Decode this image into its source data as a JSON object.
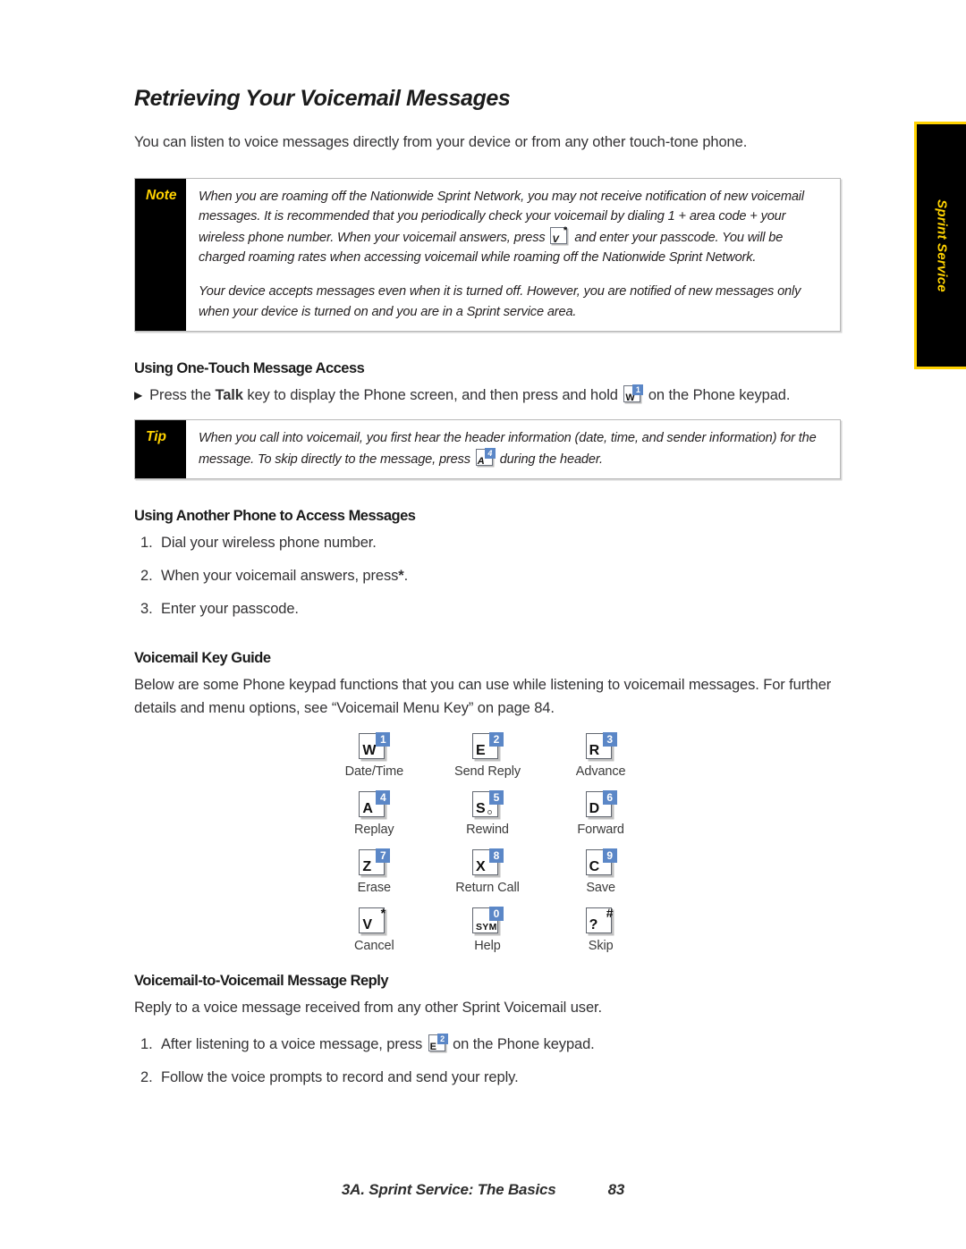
{
  "page": {
    "title": "Retrieving Your Voicemail Messages",
    "intro": "You can listen to voice messages directly from your device or from any other touch-tone phone."
  },
  "side_tab": {
    "label": "Sprint Service",
    "background": "#000000",
    "text_color": "#ffd200"
  },
  "note": {
    "label": "Note",
    "paragraph_1_a": "When you are roaming off the Nationwide Sprint Network, you may not receive notification of new voicemail messages. It is recommended that you periodically check your voicemail by dialing 1 + area code + your wireless phone number. When your voicemail answers, press",
    "paragraph_1_b": "and enter your passcode. You will be charged roaming rates when accessing voicemail while roaming off the Nationwide Sprint Network.",
    "paragraph_2": "Your device accepts messages even when it is turned off. However, you are notified of new messages only when your device is turned on and you are in a Sprint service area.",
    "inline_key": {
      "letter": "V",
      "badge": "*"
    }
  },
  "one_touch": {
    "heading": "Using One-Touch Message Access",
    "step_a": "Press the",
    "step_bold": "Talk",
    "step_b": "key to display the Phone screen, and then press and hold",
    "step_c": "on the Phone keypad.",
    "inline_key": {
      "letter": "W",
      "badge": "1"
    }
  },
  "tip": {
    "label": "Tip",
    "text_a": "When you call into voicemail, you first hear the header information (date, time, and sender information) for the message. To skip directly to the message, press",
    "text_b": "during the header.",
    "inline_key": {
      "letter": "A",
      "badge": "4"
    }
  },
  "another_phone": {
    "heading": "Using Another Phone to Access Messages",
    "steps": [
      {
        "num": "1.",
        "text": "Dial your wireless phone number."
      },
      {
        "num": "2.",
        "text_a": "When your voicemail answers, press",
        "bold": "*",
        "text_b": "."
      },
      {
        "num": "3.",
        "text": "Enter your passcode."
      }
    ]
  },
  "key_guide": {
    "heading": "Voicemail Key Guide",
    "description": "Below are some Phone keypad functions that you can use while listening to voicemail messages. For further details and menu options, see “Voicemail Menu Key” on page 84.",
    "badge_color": "#5b87c7",
    "keys": [
      {
        "letter": "W",
        "badge": "1",
        "badge_style": "blue",
        "label": "Date/Time",
        "dot": false
      },
      {
        "letter": "E",
        "badge": "2",
        "badge_style": "blue",
        "label": "Send Reply",
        "dot": false
      },
      {
        "letter": "R",
        "badge": "3",
        "badge_style": "blue",
        "label": "Advance",
        "dot": false
      },
      {
        "letter": "A",
        "badge": "4",
        "badge_style": "blue",
        "label": "Replay",
        "dot": false
      },
      {
        "letter": "S",
        "badge": "5",
        "badge_style": "blue",
        "label": "Rewind",
        "dot": true
      },
      {
        "letter": "D",
        "badge": "6",
        "badge_style": "blue",
        "label": "Forward",
        "dot": false
      },
      {
        "letter": "Z",
        "badge": "7",
        "badge_style": "blue",
        "label": "Erase",
        "dot": false
      },
      {
        "letter": "X",
        "badge": "8",
        "badge_style": "blue",
        "label": "Return Call",
        "dot": false
      },
      {
        "letter": "C",
        "badge": "9",
        "badge_style": "blue",
        "label": "Save",
        "dot": false
      },
      {
        "letter": "V",
        "badge": "*",
        "badge_style": "plain",
        "label": "Cancel",
        "dot": false
      },
      {
        "letter": "SYM",
        "badge": "0",
        "badge_style": "blue",
        "label": "Help",
        "dot": false
      },
      {
        "letter": "?",
        "badge": "#",
        "badge_style": "plain",
        "label": "Skip",
        "dot": false
      }
    ]
  },
  "vm_to_vm": {
    "heading": "Voicemail-to-Voicemail Message Reply",
    "description": "Reply to a voice message received from any other Sprint Voicemail user.",
    "step_1_num": "1.",
    "step_1_a": "After listening to a voice message, press",
    "step_1_b": "on the Phone keypad.",
    "step_1_key": {
      "letter": "E",
      "badge": "2"
    },
    "step_2_num": "2.",
    "step_2": "Follow the voice prompts to record and send your reply."
  },
  "footer": {
    "title": "3A. Sprint Service: The Basics",
    "page_number": "83"
  }
}
